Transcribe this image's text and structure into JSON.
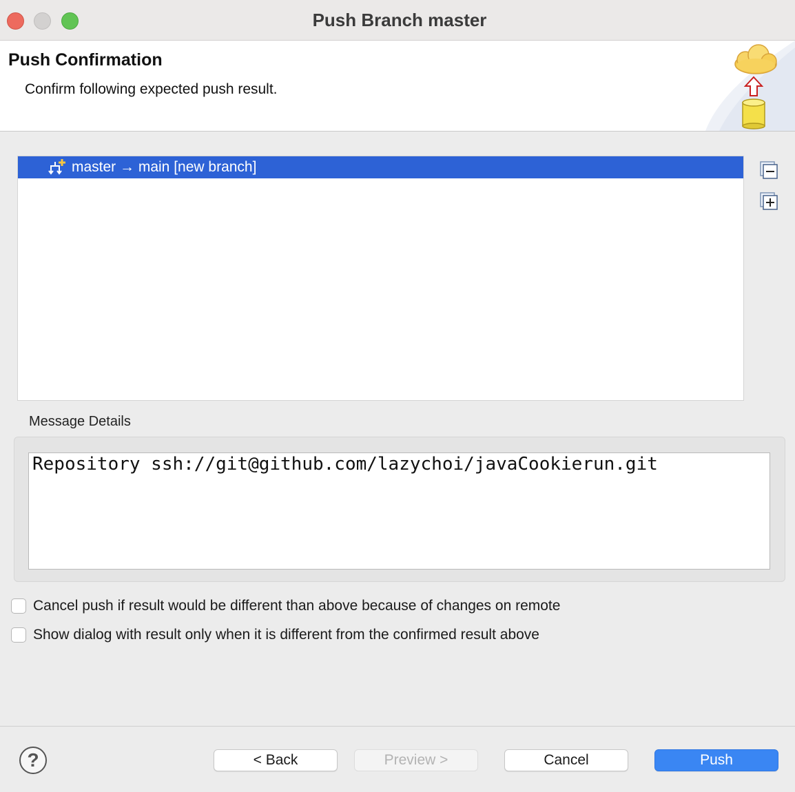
{
  "window": {
    "title": "Push Branch master"
  },
  "header": {
    "title": "Push Confirmation",
    "description": "Confirm following expected push result."
  },
  "tree": {
    "items": [
      {
        "label": "master → main [new branch]",
        "selected": true
      }
    ]
  },
  "side_buttons": {
    "collapse_all": "collapse-all-icon",
    "expand_all": "expand-all-icon"
  },
  "message_details": {
    "label": "Message Details",
    "text": "Repository ssh://git@github.com/lazychoi/javaCookierun.git"
  },
  "options": {
    "cancel_push_label": "Cancel push if result would be different than above because of changes on remote",
    "cancel_push_checked": false,
    "show_dialog_label": "Show dialog with result only when it is different from the confirmed result above",
    "show_dialog_checked": false
  },
  "footer": {
    "help": "?",
    "back_label": "< Back",
    "preview_label": "Preview >",
    "cancel_label": "Cancel",
    "push_label": "Push"
  },
  "colors": {
    "selection": "#2d62d6",
    "primary_button": "#3a86f3"
  }
}
